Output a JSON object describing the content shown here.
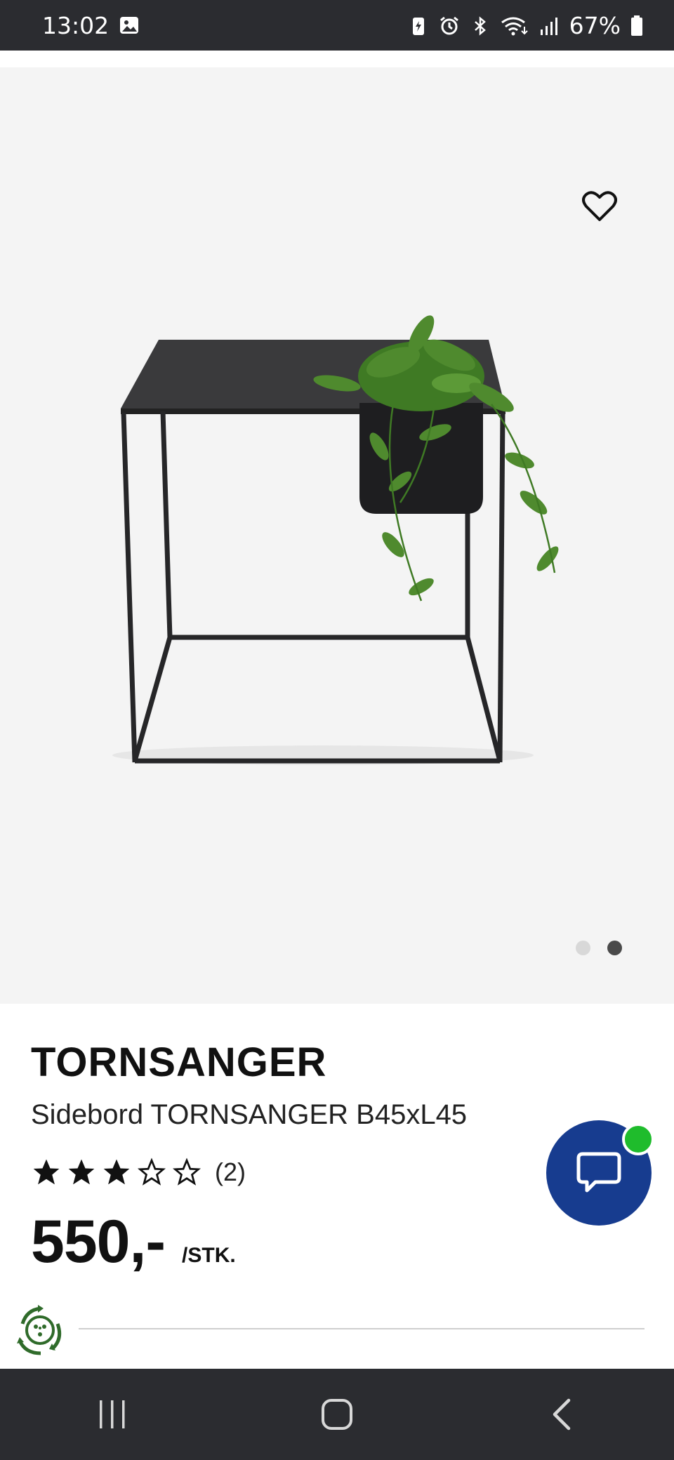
{
  "status_bar": {
    "time": "13:02",
    "battery_percent": "67%",
    "icons": [
      "gallery-icon",
      "battery-saver-icon",
      "alarm-icon",
      "bluetooth-icon",
      "wifi-icon",
      "signal-icon",
      "battery-icon"
    ]
  },
  "gallery": {
    "image_count": 2,
    "active_index": 1,
    "favorite_icon": "heart-outline-icon"
  },
  "product": {
    "name": "TORNSANGER",
    "description": "Sidebord TORNSANGER B45xL45",
    "rating": 3,
    "rating_max": 5,
    "rating_count": "(2)",
    "price": "550,-",
    "price_unit": "/STK."
  },
  "chat": {
    "icon": "chat-bubble-icon",
    "badge_color": "#1fbc2c",
    "button_color": "#173c8f"
  },
  "nav": {
    "buttons": [
      "recent-apps-icon",
      "home-icon",
      "back-icon"
    ]
  }
}
